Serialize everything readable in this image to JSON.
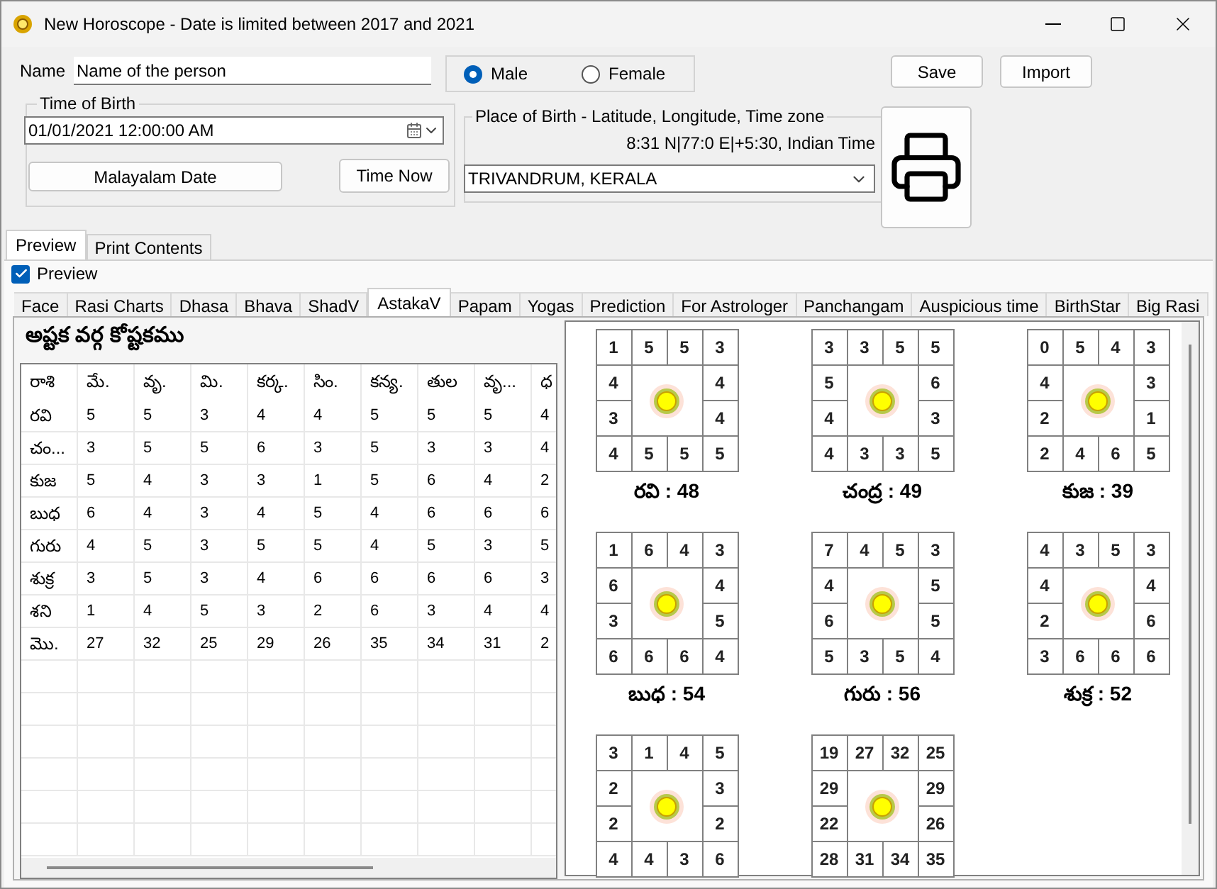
{
  "window": {
    "title": "New Horoscope - Date is limited between 2017 and 2021"
  },
  "form": {
    "name_label": "Name",
    "name_value": "Name of the person",
    "gender": [
      {
        "label": "Male",
        "selected": true
      },
      {
        "label": "Female",
        "selected": false
      }
    ],
    "time_group": "Time of Birth",
    "datetime": "01/01/2021  12:00:00 AM",
    "malayalam_button": "Malayalam Date",
    "time_now_button": "Time Now",
    "place_group": "Place of Birth - Latitude, Longitude, Time zone",
    "coordinates": "8:31 N|77:0 E|+5:30, Indian Time",
    "place": "TRIVANDRUM, KERALA",
    "buttons": [
      "Save",
      "Import"
    ]
  },
  "outer_tabs": [
    {
      "label": "Preview",
      "selected": true
    },
    {
      "label": "Print Contents",
      "selected": false
    }
  ],
  "preview_checkbox": {
    "label": "Preview",
    "checked": true
  },
  "tabs": [
    {
      "label": "Face",
      "selected": false
    },
    {
      "label": "Rasi Charts",
      "selected": false
    },
    {
      "label": "Dhasa",
      "selected": false
    },
    {
      "label": "Bhava",
      "selected": false
    },
    {
      "label": "ShadV",
      "selected": false
    },
    {
      "label": "AstakaV",
      "selected": true
    },
    {
      "label": "Papam",
      "selected": false
    },
    {
      "label": "Yogas",
      "selected": false
    },
    {
      "label": "Prediction",
      "selected": false
    },
    {
      "label": "For Astrologer",
      "selected": false
    },
    {
      "label": "Panchangam",
      "selected": false
    },
    {
      "label": "Auspicious time",
      "selected": false
    },
    {
      "label": "BirthStar",
      "selected": false
    },
    {
      "label": "Big Rasi",
      "selected": false
    }
  ],
  "astaka": {
    "title": "అష్టక వర్గ కోష్టకము",
    "columns": [
      "రాశి",
      "మే.",
      "వృ.",
      "మి.",
      "కర్క.",
      "సిం.",
      "కన్య.",
      "తుల",
      "వృ...",
      "ధ"
    ],
    "rows": [
      {
        "label": "రవి",
        "values": [
          "5",
          "5",
          "3",
          "4",
          "4",
          "5",
          "5",
          "5",
          "4"
        ]
      },
      {
        "label": "చం...",
        "values": [
          "3",
          "5",
          "5",
          "6",
          "3",
          "5",
          "3",
          "3",
          "4"
        ]
      },
      {
        "label": "కుజ",
        "values": [
          "5",
          "4",
          "3",
          "3",
          "1",
          "5",
          "6",
          "4",
          "2"
        ]
      },
      {
        "label": "బుధ",
        "values": [
          "6",
          "4",
          "3",
          "4",
          "5",
          "4",
          "6",
          "6",
          "6"
        ]
      },
      {
        "label": "గురు",
        "values": [
          "4",
          "5",
          "3",
          "5",
          "5",
          "4",
          "5",
          "3",
          "5"
        ]
      },
      {
        "label": "శుక్ర",
        "values": [
          "3",
          "5",
          "3",
          "4",
          "6",
          "6",
          "6",
          "6",
          "3"
        ]
      },
      {
        "label": "శని",
        "values": [
          "1",
          "4",
          "5",
          "3",
          "2",
          "6",
          "3",
          "4",
          "4"
        ]
      },
      {
        "label": "మొ.",
        "values": [
          "27",
          "32",
          "25",
          "29",
          "26",
          "35",
          "34",
          "31",
          "2"
        ]
      }
    ],
    "charts": [
      {
        "caption": "రవి : 48",
        "cells": [
          "1",
          "5",
          "5",
          "3",
          "4",
          "4",
          "3",
          "4",
          "4",
          "5",
          "5",
          "5"
        ]
      },
      {
        "caption": "చంద్ర : 49",
        "cells": [
          "3",
          "3",
          "5",
          "5",
          "5",
          "6",
          "4",
          "3",
          "4",
          "3",
          "3",
          "5"
        ]
      },
      {
        "caption": "కుజ : 39",
        "cells": [
          "0",
          "5",
          "4",
          "3",
          "4",
          "3",
          "2",
          "1",
          "2",
          "4",
          "6",
          "5"
        ]
      },
      {
        "caption": "బుధ : 54",
        "cells": [
          "1",
          "6",
          "4",
          "3",
          "6",
          "4",
          "3",
          "5",
          "6",
          "6",
          "6",
          "4"
        ]
      },
      {
        "caption": "గురు : 56",
        "cells": [
          "7",
          "4",
          "5",
          "3",
          "4",
          "5",
          "6",
          "5",
          "5",
          "3",
          "5",
          "4"
        ]
      },
      {
        "caption": "శుక్ర : 52",
        "cells": [
          "4",
          "3",
          "5",
          "3",
          "4",
          "4",
          "2",
          "6",
          "3",
          "6",
          "6",
          "6"
        ]
      },
      {
        "cells": [
          "3",
          "1",
          "4",
          "5",
          "2",
          "3",
          "2",
          "2",
          "4",
          "4",
          "3",
          "6"
        ]
      },
      {
        "cells": [
          "19",
          "27",
          "32",
          "25",
          "29",
          "29",
          "22",
          "26",
          "28",
          "31",
          "34",
          "35"
        ]
      }
    ]
  }
}
